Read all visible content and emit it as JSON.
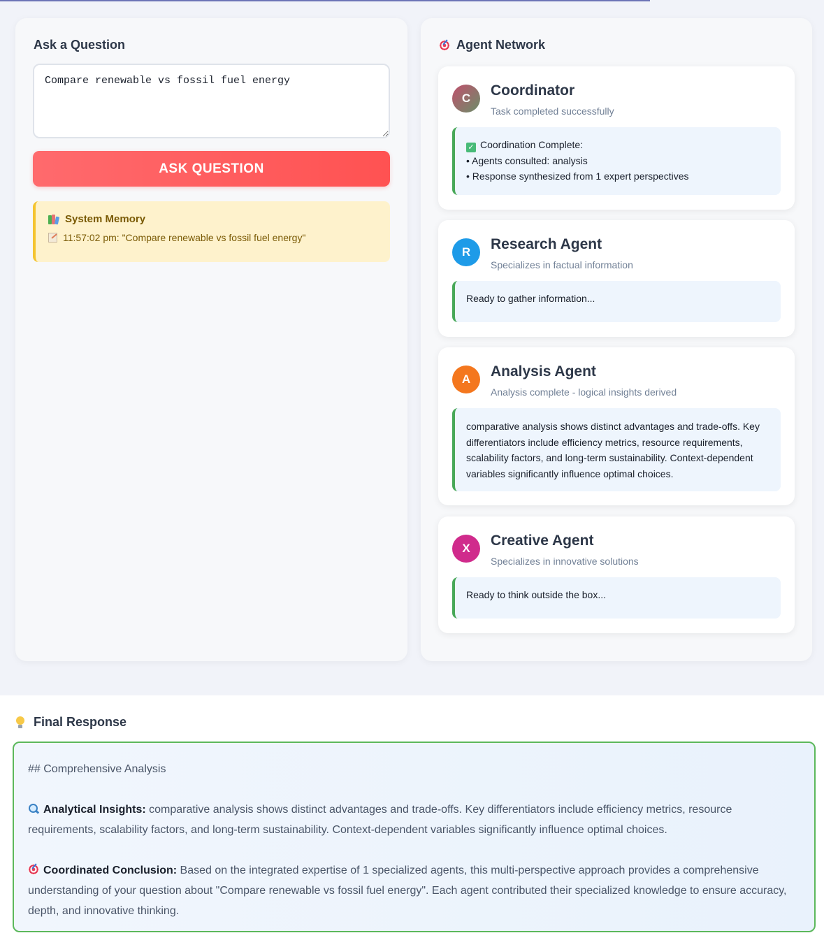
{
  "left_panel": {
    "title": "Ask a Question",
    "question_value": "Compare renewable vs fossil fuel energy",
    "ask_button_label": "ASK QUESTION",
    "memory": {
      "title": "System Memory",
      "entry": "11:57:02 pm: \"Compare renewable vs fossil fuel energy\""
    }
  },
  "right_panel": {
    "title": "Agent Network",
    "agents": [
      {
        "initial": "C",
        "name": "Coordinator",
        "status": "Task completed successfully",
        "output_lines": [
          "Coordination Complete:",
          "• Agents consulted: analysis",
          "• Response synthesized from 1 expert perspectives"
        ],
        "avatar_color": "#8e5fa8"
      },
      {
        "initial": "R",
        "name": "Research Agent",
        "status": "Specializes in factual information",
        "output": "Ready to gather information...",
        "avatar_color": "#1e9be8"
      },
      {
        "initial": "A",
        "name": "Analysis Agent",
        "status": "Analysis complete - logical insights derived",
        "output": "comparative analysis shows distinct advantages and trade-offs. Key differentiators include efficiency metrics, resource requirements, scalability factors, and long-term sustainability. Context-dependent variables significantly influence optimal choices.",
        "avatar_color": "#f4771e"
      },
      {
        "initial": "X",
        "name": "Creative Agent",
        "status": "Specializes in innovative solutions",
        "output": "Ready to think outside the box...",
        "avatar_color": "#d02b8c"
      }
    ]
  },
  "final_response": {
    "title": "Final Response",
    "heading": "## Comprehensive Analysis",
    "insights_label": "Analytical Insights:",
    "insights_text": " comparative analysis shows distinct advantages and trade-offs. Key differentiators include efficiency metrics, resource requirements, scalability factors, and long-term sustainability. Context-dependent variables significantly influence optimal choices.",
    "conclusion_label": "Coordinated Conclusion:",
    "conclusion_text": " Based on the integrated expertise of 1 specialized agents, this multi-perspective approach provides a comprehensive understanding of your question about \"Compare renewable vs fossil fuel energy\". Each agent contributed their specialized knowledge to ensure accuracy, depth, and innovative thinking."
  },
  "colors": {
    "accent_red": "#ff5252",
    "success_green": "#48a858",
    "memory_yellow": "#f4c430"
  }
}
